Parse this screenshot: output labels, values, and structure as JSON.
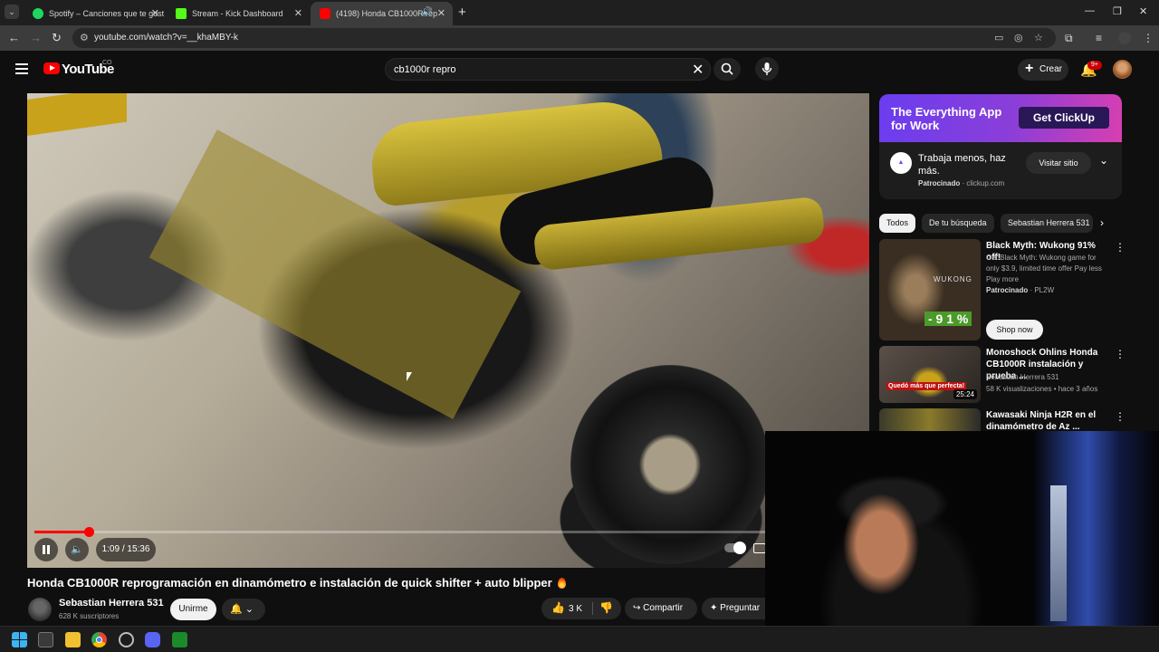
{
  "browser": {
    "tabs": [
      {
        "title": "Spotify – Canciones que te gust",
        "color": "#1ed760"
      },
      {
        "title": "Stream - Kick Dashboard",
        "color": "#53fc18"
      },
      {
        "title": "(4198) Honda CB1000R rep",
        "color": "#ff0000"
      }
    ],
    "url": "youtube.com/watch?v=__khaMBY-k"
  },
  "header": {
    "logo_text": "YouTube",
    "country_code": "CO",
    "search_query": "cb1000r repro",
    "create_label": "Crear",
    "notification_count": "9+"
  },
  "player": {
    "time": "1:09 / 15:36",
    "progress": 0.0737
  },
  "video": {
    "title": "Honda CB1000R reprogramación en dinamómetro e instalación de quick shifter + auto blipper",
    "channel": "Sebastian Herrera 531",
    "subscribers": "628 K suscriptores",
    "join_label": "Unirme",
    "likes": "3 K",
    "share_label": "Compartir",
    "ask_label": "Preguntar"
  },
  "ad": {
    "headline": "The Everything App for Work",
    "cta": "Get ClickUp",
    "description": "Trabaja menos, haz más.",
    "sponsored": "Patrocinado",
    "domain": "clickup.com",
    "visit_label": "Visitar sitio",
    "brand_color": "#7b3fe8"
  },
  "chips": [
    {
      "label": "Todos",
      "selected": true
    },
    {
      "label": "De tu búsqueda",
      "selected": false
    },
    {
      "label": "Sebastian Herrera 531",
      "selected": false
    }
  ],
  "related": [
    {
      "title": "Black Myth: Wukong 91% off!",
      "desc": "Get Black Myth: Wukong game for only $3.9, limited time offer Pay less Play more",
      "sponsored": "Patrocinado",
      "advertiser": "PL2W",
      "discount": "- 9 1 %",
      "shop_label": "Shop now",
      "thumb_text": "WUKONG"
    },
    {
      "title": "Monoshock Ohlins Honda CB1000R instalación y prueba ...",
      "channel": "Sebastian Herrera 531",
      "stats": "58 K visualizaciones • hace 3 años",
      "duration": "25:24",
      "thumb_text": "Quedó más que perfecta!"
    },
    {
      "title": "Kawasaki Ninja H2R en el dinamómetro de Az ..."
    }
  ]
}
